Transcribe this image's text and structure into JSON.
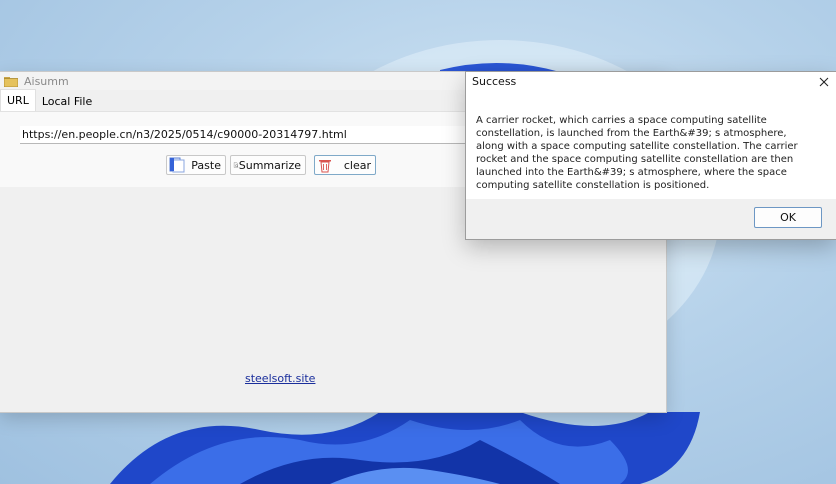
{
  "app": {
    "title": "Aisumm",
    "tabs": [
      {
        "label": "URL",
        "active": true
      },
      {
        "label": "Local File",
        "active": false
      }
    ],
    "url_value": "https://en.people.cn/n3/2025/0514/c90000-20314797.html",
    "buttons": {
      "paste": "Paste",
      "summarize": "Summarize",
      "clear": "clear"
    },
    "footer_link": "steelsoft.site"
  },
  "dialog": {
    "title": "Success",
    "message": "A carrier rocket, which carries a space computing satellite constellation, is launched from the Earth&#39; s atmosphere, along with a space computing satellite constellation. The carrier rocket and the space computing satellite constellation are then launched into the Earth&#39; s atmosphere, where the space computing satellite constellation is positioned.",
    "ok_label": "OK",
    "close_icon": "close-icon"
  },
  "colors": {
    "accent": "#2f5fd6",
    "link": "#1a2e9c",
    "wallpaper": "#b6d2ea"
  }
}
